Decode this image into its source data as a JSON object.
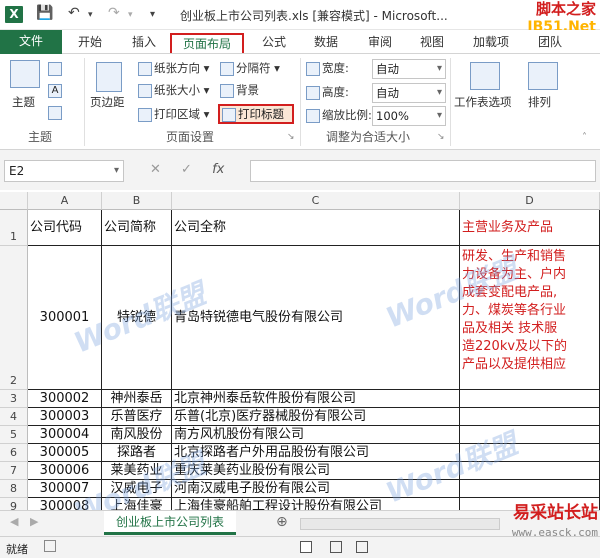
{
  "window": {
    "title": "创业板上市公司列表.xls [兼容模式] - Microsoft...",
    "watermark_top_line1": "脚本之家",
    "watermark_top_line2": "JB51.Net"
  },
  "ribbon_tabs": [
    "文件",
    "开始",
    "插入",
    "页面布局",
    "公式",
    "数据",
    "审阅",
    "视图",
    "加载项",
    "团队"
  ],
  "active_tab": "页面布局",
  "ribbon": {
    "themes": {
      "button": "主题",
      "group": "主题"
    },
    "page_setup": {
      "margins": "页边距",
      "orientation": "纸张方向",
      "size": "纸张大小",
      "print_area": "打印区域",
      "breaks": "分隔符",
      "background": "背景",
      "print_titles": "打印标题",
      "group": "页面设置"
    },
    "scale": {
      "width_label": "宽度:",
      "width_value": "自动",
      "height_label": "高度:",
      "height_value": "自动",
      "scale_label": "缩放比例:",
      "scale_value": "100%",
      "group": "调整为合适大小"
    },
    "sheet_options": "工作表选项",
    "arrange": "排列"
  },
  "formula_bar": {
    "name_box": "E2",
    "fx": "fx",
    "content": ""
  },
  "columns": [
    "A",
    "B",
    "C",
    "D"
  ],
  "rows": [
    {
      "row": "1",
      "code": "公司代码",
      "short": "公司简称",
      "full": "公司全称",
      "business": "主营业务及产品"
    },
    {
      "row": "2",
      "code": "300001",
      "short": "特锐德",
      "full": "青岛特锐德电气股份有限公司",
      "business_lines": [
        "研发、生产和销售",
        "力设备为主、户内",
        "成套变配电产品,",
        "力、煤炭等各行业",
        "品及相关 技术服",
        "造220kv及以下的",
        "产品以及提供相应"
      ]
    },
    {
      "row": "3",
      "code": "300002",
      "short": "神州泰岳",
      "full": "北京神州泰岳软件股份有限公司",
      "business": ""
    },
    {
      "row": "4",
      "code": "300003",
      "short": "乐普医疗",
      "full": "乐普(北京)医疗器械股份有限公司",
      "business": ""
    },
    {
      "row": "5",
      "code": "300004",
      "short": "南风股份",
      "full": "南方风机股份有限公司",
      "business": ""
    },
    {
      "row": "6",
      "code": "300005",
      "short": "探路者",
      "full": "北京探路者户外用品股份有限公司",
      "business": ""
    },
    {
      "row": "7",
      "code": "300006",
      "short": "莱美药业",
      "full": "重庆莱美药业股份有限公司",
      "business": ""
    },
    {
      "row": "8",
      "code": "300007",
      "short": "汉威电子",
      "full": "河南汉威电子股份有限公司",
      "business": ""
    },
    {
      "row": "9",
      "code": "300008",
      "short": "上海佳豪",
      "full": "上海佳豪船舶工程设计股份有限公司",
      "business": ""
    }
  ],
  "watermark_grid": "Word联盟",
  "sheet_tab": "创业板上市公司列表",
  "status": {
    "ready": "就绪"
  },
  "watermark_bottom": {
    "line1": "易采站长站",
    "url": "www.easck.com"
  },
  "accent_color": "#217346",
  "highlight_color": "#d21e1e"
}
